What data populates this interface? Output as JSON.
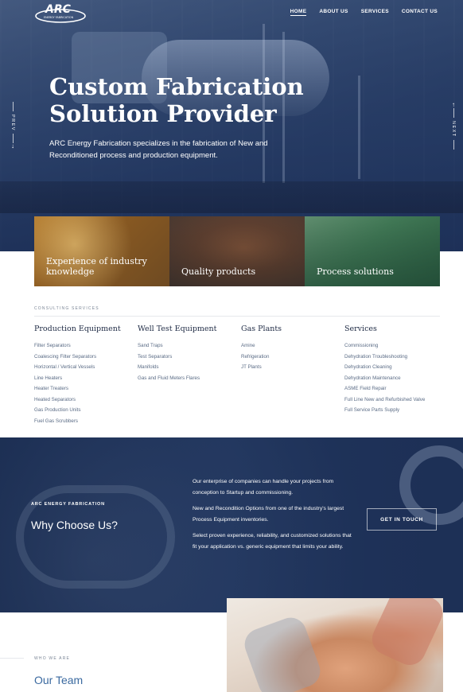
{
  "nav": {
    "items": [
      {
        "label": "HOME",
        "active": true
      },
      {
        "label": "ABOUT US",
        "active": false
      },
      {
        "label": "SERVICES",
        "active": false
      },
      {
        "label": "CONTACT US",
        "active": false
      }
    ]
  },
  "logo": {
    "text": "ARC",
    "subtext": "ENERGY FABRICATION"
  },
  "hero": {
    "title_line1": "Custom Fabrication",
    "title_line2": "Solution Provider",
    "subtitle": "ARC Energy Fabrication specializes in the fabrication of New and Reconditioned process and production equipment.",
    "prev_label": "PREV",
    "next_label": "NEXT"
  },
  "tiles": [
    {
      "label": "Experience of industry knowledge"
    },
    {
      "label": "Quality products"
    },
    {
      "label": "Process solutions"
    }
  ],
  "services_section": {
    "kicker": "CONSULTING SERVICES",
    "columns": [
      {
        "heading": "Production Equipment",
        "items": [
          "Filter Separators",
          "Coalescing Filter Separators",
          "Horizontal / Vertical Vessels",
          "Line Heaters",
          "Heater Treaters",
          "Heated Separators",
          "Gas Production Units",
          "Fuel Gas Scrubbers"
        ]
      },
      {
        "heading": "Well Test Equipment",
        "items": [
          "Sand Traps",
          "Test Separators",
          "Manifolds",
          "Gas and Fluid Meters Flares"
        ]
      },
      {
        "heading": "Gas Plants",
        "items": [
          "Amine",
          "Refrigeration",
          "JT Plants"
        ]
      },
      {
        "heading": "Services",
        "items": [
          "Commissioning",
          "Dehydration Troubleshooting",
          "Dehydration Cleaning",
          "Dehydration Maintenance",
          "ASME Field Repair",
          "Full Line New and Refurbished Valve",
          "Full Service Parts Supply"
        ]
      }
    ]
  },
  "why": {
    "kicker": "ARC ENERGY FABRICATION",
    "title": "Why Choose Us?",
    "paragraphs": [
      "Our enterprise of companies can handle your projects from conception to Startup and commissioning.",
      "New and Recondition Options from one of the industry's largest Process Equipment inventories.",
      "Select proven experience, reliability, and customized solutions that fit your application vs. generic equipment that limits your ability."
    ],
    "cta_label": "GET IN TOUCH"
  },
  "team": {
    "kicker": "WHO WE ARE",
    "title": "Our Team"
  },
  "colors": {
    "navy": "#1e2a44",
    "accent_blue": "#3b6aa0",
    "link_gray": "#5a6b85"
  }
}
